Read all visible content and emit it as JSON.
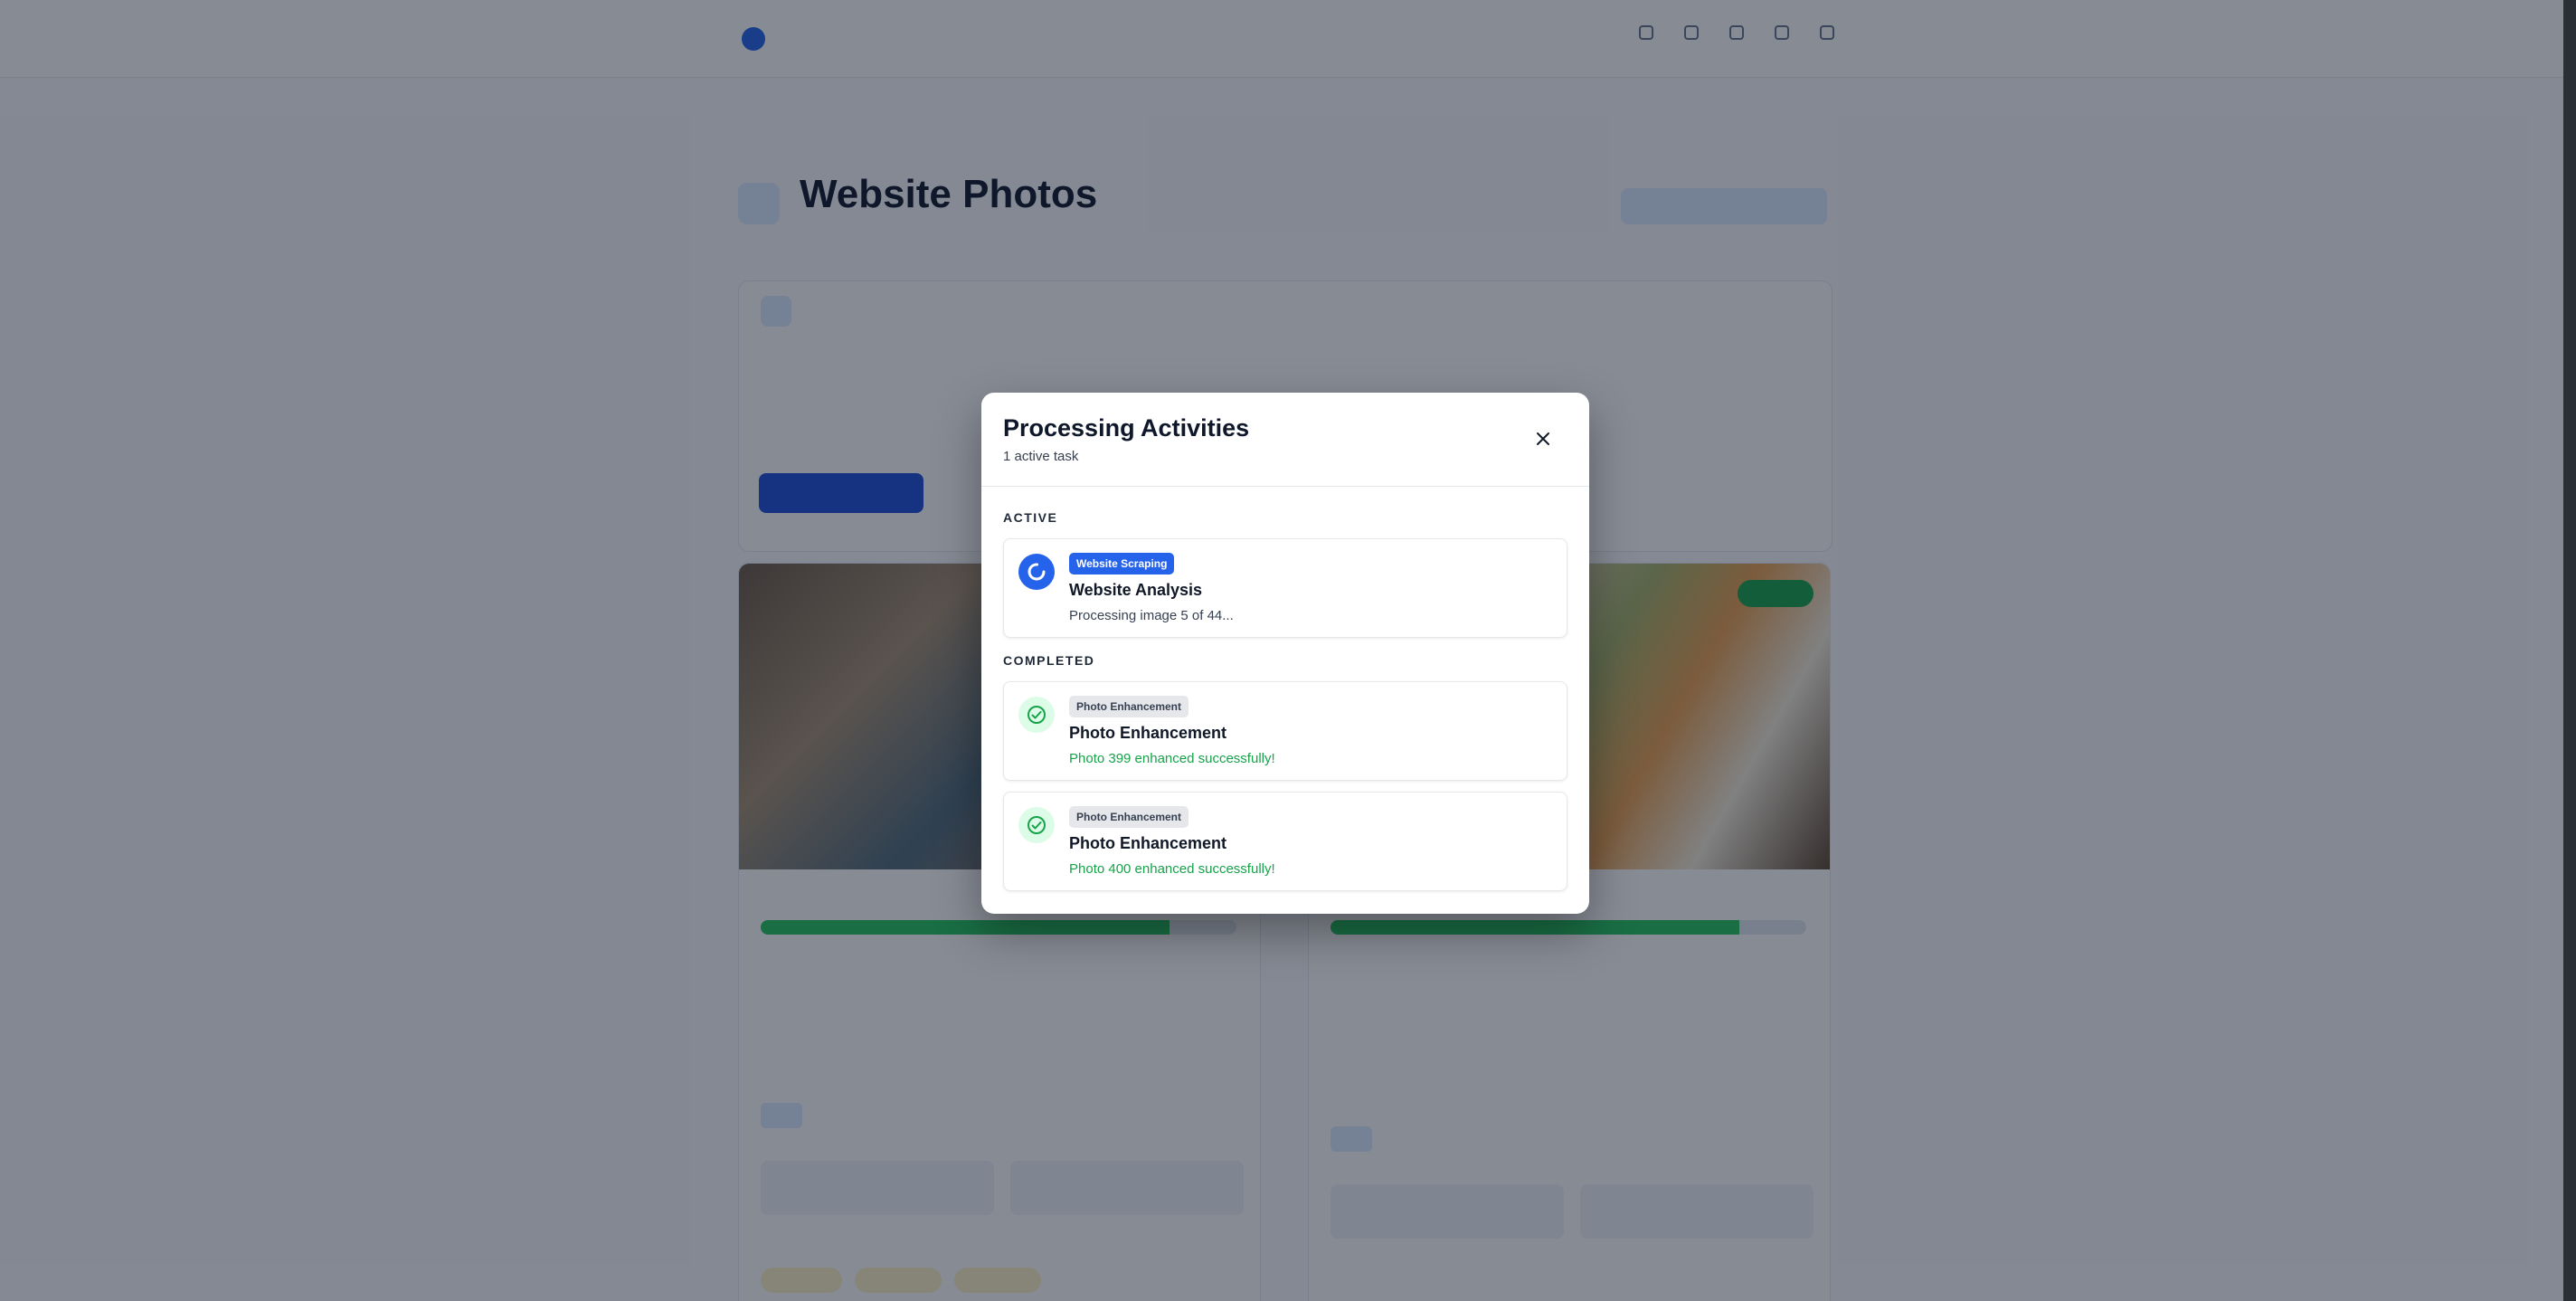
{
  "modal": {
    "title": "Processing Activities",
    "subtitle": "1 active task",
    "close_icon": "close-icon",
    "sections": {
      "active_label": "ACTIVE",
      "completed_label": "COMPLETED"
    },
    "active_tasks": [
      {
        "badge": "Website Scraping",
        "name": "Website Analysis",
        "message": "Processing image 5 of 44...",
        "icon": "spinner-icon"
      }
    ],
    "completed_tasks": [
      {
        "badge": "Photo Enhancement",
        "name": "Photo Enhancement",
        "message": "Photo 399 enhanced successfully!",
        "icon": "check-circle-icon"
      },
      {
        "badge": "Photo Enhancement",
        "name": "Photo Enhancement",
        "message": "Photo 400 enhanced successfully!",
        "icon": "check-circle-icon"
      }
    ]
  },
  "background": {
    "page_title": "Website Photos",
    "photo_quality_levels": [
      0.86,
      0.86
    ]
  },
  "colors": {
    "accent": "#2563eb",
    "success": "#16a34a",
    "overlay": "rgba(15,23,42,0.5)"
  }
}
